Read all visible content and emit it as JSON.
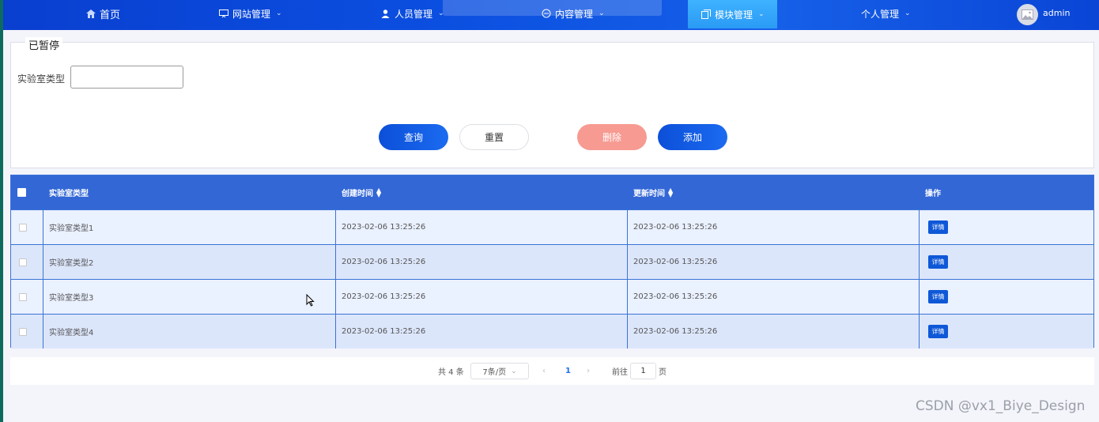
{
  "nav": {
    "home": "首页",
    "items": [
      {
        "label": "网站管理",
        "icon": "monitor-icon"
      },
      {
        "label": "人员管理",
        "icon": "user-icon"
      },
      {
        "label": "内容管理",
        "icon": "chat-icon"
      },
      {
        "label": "模块管理",
        "icon": "module-icon"
      },
      {
        "label": "个人管理",
        "icon": ""
      }
    ],
    "active": "模块管理",
    "username": "admin"
  },
  "search": {
    "legend": "已暂停",
    "field_label": "实验室类型",
    "field_value": "",
    "query_label": "查询",
    "reset_label": "重置",
    "delete_label": "删除",
    "add_label": "添加"
  },
  "table": {
    "headers": [
      "实验室类型",
      "创建时间",
      "更新时间",
      "操作"
    ],
    "rows": [
      {
        "type": "实验室类型1",
        "created": "2023-02-06 13:25:26",
        "updated": "2023-02-06 13:25:26",
        "action": "详情"
      },
      {
        "type": "实验室类型2",
        "created": "2023-02-06 13:25:26",
        "updated": "2023-02-06 13:25:26",
        "action": "详情"
      },
      {
        "type": "实验室类型3",
        "created": "2023-02-06 13:25:26",
        "updated": "2023-02-06 13:25:26",
        "action": "详情"
      },
      {
        "type": "实验室类型4",
        "created": "2023-02-06 13:25:26",
        "updated": "2023-02-06 13:25:26",
        "action": "详情"
      }
    ]
  },
  "pagination": {
    "total": "共 4 条",
    "page_size": "7条/页",
    "current_page": "1",
    "goto_label": "前往",
    "goto_value": "1",
    "page_suffix": "页"
  },
  "watermark": "CSDN @vx1_Biye_Design"
}
